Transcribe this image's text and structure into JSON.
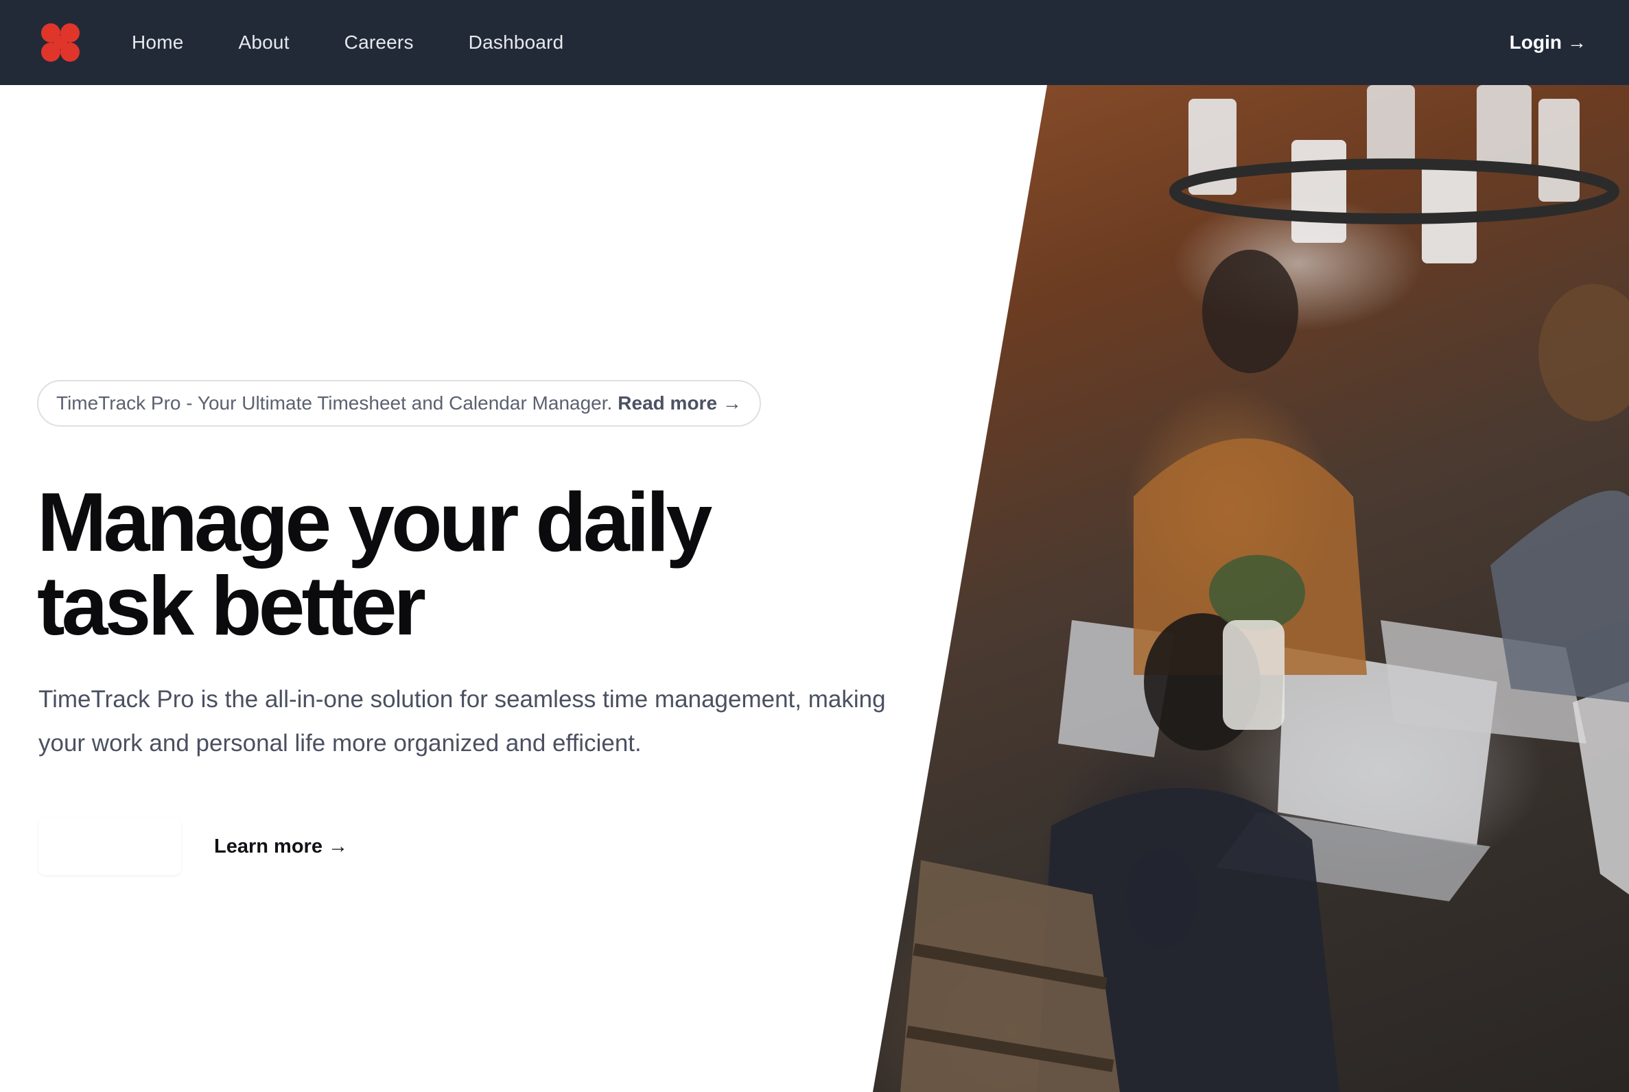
{
  "nav": {
    "logo_icon": "clover-logo-icon",
    "links": [
      "Home",
      "About",
      "Careers",
      "Dashboard"
    ],
    "login_label": "Login",
    "login_arrow": "→"
  },
  "announcement": {
    "text": "TimeTrack Pro - Your Ultimate Timesheet and Calendar Manager.",
    "link_label": "Read more",
    "link_arrow": "→"
  },
  "hero": {
    "headline": "Manage your daily task better",
    "description": "TimeTrack Pro is the all-in-one solution for seamless time management, making your work and personal life more organized and efficient.",
    "primary_cta_label": "",
    "secondary_cta_label": "Learn more",
    "secondary_cta_arrow": "→"
  },
  "colors": {
    "navbar_bg": "#222a38",
    "logo": "#e0352b",
    "headline": "#0b0b0d",
    "body_text": "#4a5060"
  }
}
